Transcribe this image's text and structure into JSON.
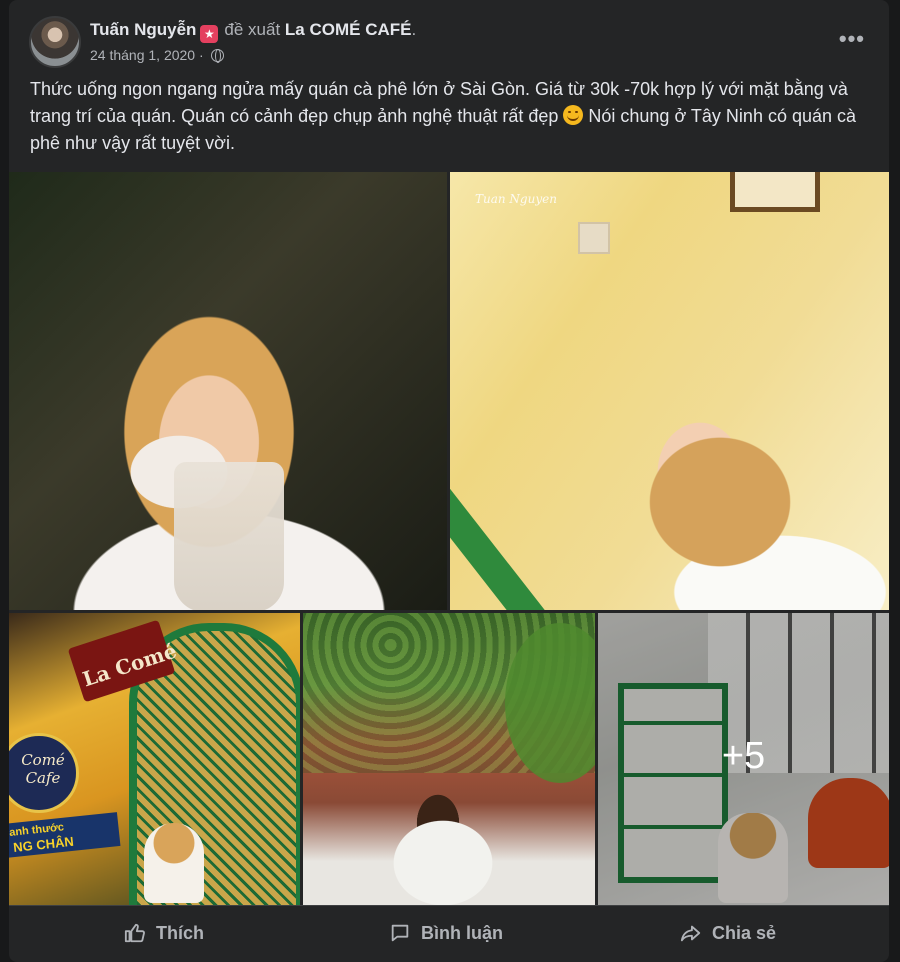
{
  "post": {
    "author": "Tuấn Nguyễn",
    "badge": "★",
    "verb": "đề xuất",
    "page": "La COMÉ CAFÉ",
    "page_suffix": ".",
    "date": "24 tháng 1, 2020 ·",
    "more": "•••",
    "text_before_emoji": "Thức uống ngon ngang ngửa mấy quán cà phê lớn ở Sài Gòn. Giá từ 30k -70k hợp lý với mặt bằng và trang trí của quán. Quán có cảnh đẹp chụp ảnh nghệ thuật rất đẹp ",
    "text_after_emoji": " Nói chung ở Tây Ninh có quán cà phê  như vậy rất tuyệt vời."
  },
  "photos": {
    "watermark": "Tuan Nguyen",
    "sign_text": "La Comé",
    "circle_text_1": "Comé",
    "circle_text_2": "Cafe",
    "band_text_1": "anh thước",
    "band_text_2": "NG CHÂN",
    "more_count": "+5"
  },
  "actions": {
    "like": "Thích",
    "comment": "Bình luận",
    "share": "Chia sẻ"
  },
  "icons": [
    "globe-icon",
    "more-icon",
    "like-icon",
    "comment-icon",
    "share-icon",
    "smile-emoji-icon"
  ],
  "colors": {
    "background": "#242526",
    "text": "#e4e6eb",
    "secondary": "#b0b3b8",
    "badge": "#e4405f"
  }
}
